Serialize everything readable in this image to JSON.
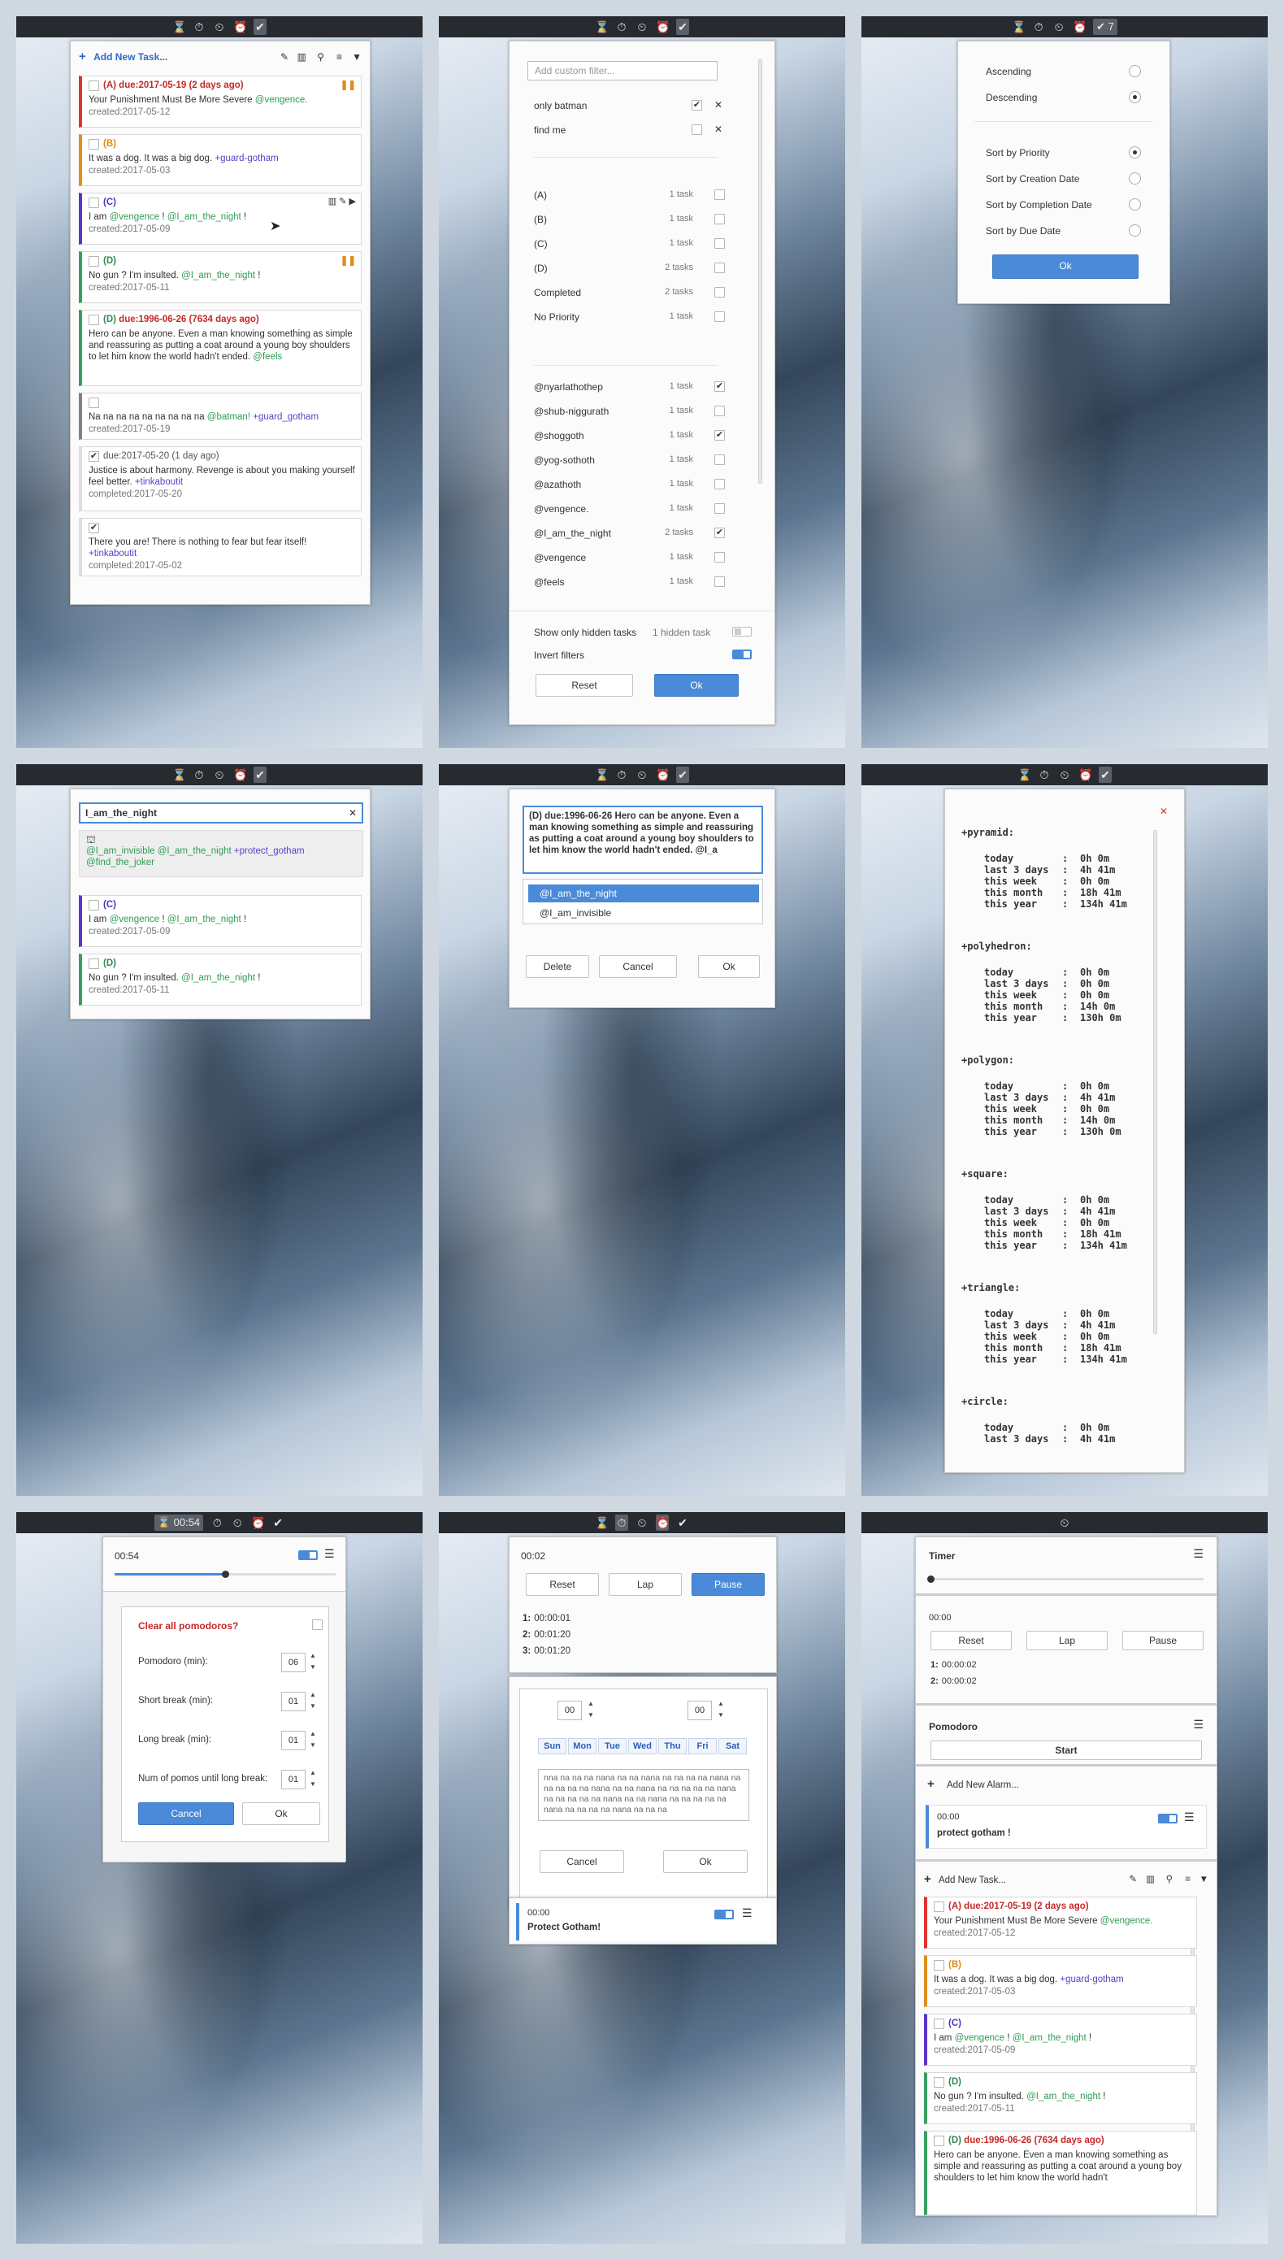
{
  "topbar": {
    "timer_label": "00:54",
    "badge_7": "7"
  },
  "icons": {
    "hourglass": "⌛",
    "stopwatch": "⏱",
    "timer": "⏲",
    "alarm": "⏰",
    "check": "✔"
  },
  "colors": {
    "accent": "#4a8ad9",
    "priority_a": "#d33333",
    "priority_b": "#e38d1f",
    "priority_c": "#5b34c8",
    "priority_d": "#37a060",
    "context": "#2e9c54",
    "project": "#5a3fc6"
  },
  "todo": {
    "add_task": "Add New Task...",
    "tasks": [
      {
        "pri": "(A)",
        "due": "due:2017-05-19 (2 days ago)",
        "text": "Your Punishment Must Be More Severe",
        "tag": "@vengence.",
        "created": "created:2017-05-12"
      },
      {
        "pri": "(B)",
        "text": "It was a dog. It was a big dog.",
        "tag": "+guard-gotham",
        "created": "created:2017-05-03"
      },
      {
        "pri": "(C)",
        "text_a": "I am",
        "tag1": "@vengence",
        "mid": "!",
        "tag2": "@I_am_the_night",
        "end": "!",
        "created": "created:2017-05-09"
      },
      {
        "pri": "(D)",
        "text": "No gun ? I'm insulted.",
        "tag": "@I_am_the_night",
        "end": "!",
        "created": "created:2017-05-11"
      },
      {
        "pri": "(D)",
        "due": "due:1996-06-26 (7634 days ago)",
        "text": "Hero can be anyone. Even a man knowing something as simple and reassuring as putting a coat around a young boy shoulders to let him know the world hadn't ended.",
        "tag": "@feels"
      },
      {
        "text": "Na na na na na na na na na",
        "tag1": "@batman!",
        "tag2": "+guard_gotham",
        "created": "created:2017-05-19"
      },
      {
        "due": "due:2017-05-20 (1 day ago)",
        "text": "Justice is about harmony. Revenge is about you making yourself feel better.",
        "tag": "+tinkaboutit",
        "completed": "completed:2017-05-20"
      },
      {
        "text": "There you are! There is nothing to fear but fear itself!",
        "tag": "+tinkaboutit",
        "completed": "completed:2017-05-02"
      }
    ],
    "short_tasks": [
      {
        "pri": "(A)",
        "due": "due:2017-05-19 (2 days ago)",
        "text": "Your Punishment Must Be More Severe",
        "tag": "@vengence.",
        "created": "created:2017-05-12"
      },
      {
        "pri": "(D)",
        "due": "due:1996-06-26 (7634 days ago)",
        "text": "Hero can be anyone. Even a man knowing something as simple and reassuring as putting a coat around a young boy shoulders to let him know the world hadn't"
      }
    ]
  },
  "filter": {
    "placeholder": "Add custom filter...",
    "custom": [
      "only batman",
      "find me"
    ],
    "items": [
      {
        "label": "(A)",
        "count": "1 task",
        "checked": false
      },
      {
        "label": "(B)",
        "count": "1 task",
        "checked": false
      },
      {
        "label": "(C)",
        "count": "1 task",
        "checked": false
      },
      {
        "label": "(D)",
        "count": "2 tasks",
        "checked": false
      },
      {
        "label": "Completed",
        "count": "2 tasks",
        "checked": false
      },
      {
        "label": "No Priority",
        "count": "1 task",
        "checked": false
      }
    ],
    "contexts": [
      {
        "label": "@nyarlathothep",
        "count": "1 task",
        "checked": true
      },
      {
        "label": "@shub-niggurath",
        "count": "1 task",
        "checked": false
      },
      {
        "label": "@shoggoth",
        "count": "1 task",
        "checked": true
      },
      {
        "label": "@yog-sothoth",
        "count": "1 task",
        "checked": false
      },
      {
        "label": "@azathoth",
        "count": "1 task",
        "checked": false
      },
      {
        "label": "@vengence.",
        "count": "1 task",
        "checked": false
      },
      {
        "label": "@I_am_the_night",
        "count": "2 tasks",
        "checked": true
      },
      {
        "label": "@vengence",
        "count": "1 task",
        "checked": false
      },
      {
        "label": "@feels",
        "count": "1 task",
        "checked": false
      }
    ],
    "hidden_label": "Show only hidden tasks",
    "hidden_count": "1 hidden task",
    "invert": "Invert filters",
    "reset": "Reset",
    "ok": "Ok"
  },
  "sort": {
    "ascending": "Ascending",
    "descending": "Descending",
    "by_priority": "Sort by Priority",
    "by_creation": "Sort by Creation Date",
    "by_completion": "Sort by Completion Date",
    "by_due": "Sort by Due Date",
    "ok": "Ok"
  },
  "search": {
    "value": "I_am_the_night",
    "suggest": [
      "@I_am_invisible",
      "@I_am_the_night",
      "+protect_gotham",
      "@find_the_joker"
    ]
  },
  "editor": {
    "text": "(D) due:1996-06-26 Hero can be anyone. Even a man knowing something as simple and reassuring as putting a coat around a young boy shoulders to let him know the world hadn't ended. @I_a",
    "options": [
      "@I_am_the_night",
      "@I_am_invisible"
    ],
    "delete": "Delete",
    "cancel": "Cancel",
    "ok": "Ok"
  },
  "stats": [
    {
      "name": "+pyramid:",
      "rows": [
        [
          "today",
          "0h 0m"
        ],
        [
          "last 3 days",
          "4h 41m"
        ],
        [
          "this week",
          "0h 0m"
        ],
        [
          "this month",
          "18h 41m"
        ],
        [
          "this year",
          "134h 41m"
        ]
      ]
    },
    {
      "name": "+polyhedron:",
      "rows": [
        [
          "today",
          "0h 0m"
        ],
        [
          "last 3 days",
          "0h 0m"
        ],
        [
          "this week",
          "0h 0m"
        ],
        [
          "this month",
          "14h 0m"
        ],
        [
          "this year",
          "130h 0m"
        ]
      ]
    },
    {
      "name": "+polygon:",
      "rows": [
        [
          "today",
          "0h 0m"
        ],
        [
          "last 3 days",
          "4h 41m"
        ],
        [
          "this week",
          "0h 0m"
        ],
        [
          "this month",
          "14h 0m"
        ],
        [
          "this year",
          "130h 0m"
        ]
      ]
    },
    {
      "name": "+square:",
      "rows": [
        [
          "today",
          "0h 0m"
        ],
        [
          "last 3 days",
          "4h 41m"
        ],
        [
          "this week",
          "0h 0m"
        ],
        [
          "this month",
          "18h 41m"
        ],
        [
          "this year",
          "134h 41m"
        ]
      ]
    },
    {
      "name": "+triangle:",
      "rows": [
        [
          "today",
          "0h 0m"
        ],
        [
          "last 3 days",
          "4h 41m"
        ],
        [
          "this week",
          "0h 0m"
        ],
        [
          "this month",
          "18h 41m"
        ],
        [
          "this year",
          "134h 41m"
        ]
      ]
    },
    {
      "name": "+circle:",
      "rows": [
        [
          "today",
          "0h 0m"
        ],
        [
          "last 3 days",
          "4h 41m"
        ]
      ]
    }
  ],
  "pomodoro": {
    "time": "00:54",
    "progress": 0.5,
    "clear": "Clear all pomodoros?",
    "fields": [
      {
        "label": "Pomodoro (min):",
        "value": "06"
      },
      {
        "label": "Short break (min):",
        "value": "01"
      },
      {
        "label": "Long break (min):",
        "value": "01"
      },
      {
        "label": "Num of pomos until long break:",
        "value": "01"
      }
    ],
    "cancel": "Cancel",
    "ok": "Ok"
  },
  "stopwatch": {
    "time": "00:02",
    "reset": "Reset",
    "lap": "Lap",
    "pause": "Pause",
    "laps": [
      {
        "n": "1:",
        "t": "00:00:01"
      },
      {
        "n": "2:",
        "t": "00:01:20"
      },
      {
        "n": "3:",
        "t": "00:01:20"
      }
    ],
    "hours": "00",
    "minutes": "00",
    "days": [
      "Sun",
      "Mon",
      "Tue",
      "Wed",
      "Thu",
      "Fri",
      "Sat"
    ],
    "message": "nna na na na nana na na nana na na na na nana na na na na na nana na na nana na na na na na nana na na na na na nana na na nana na na na na na nana na na na na nana na na na",
    "cancel": "Cancel",
    "ok": "Ok",
    "alarm_time": "00:00",
    "alarm_name": "Protect Gotham!"
  },
  "all": {
    "timer_title": "Timer",
    "timer_time": "00:00",
    "sw_time": "00:00",
    "laps": [
      {
        "n": "1:",
        "t": "00:00:02"
      },
      {
        "n": "2:",
        "t": "00:00:02"
      }
    ],
    "pomodoro_title": "Pomodoro",
    "start": "Start",
    "add_alarm": "Add New Alarm...",
    "alarm_time": "00:00",
    "alarm_name": "protect gotham !"
  }
}
